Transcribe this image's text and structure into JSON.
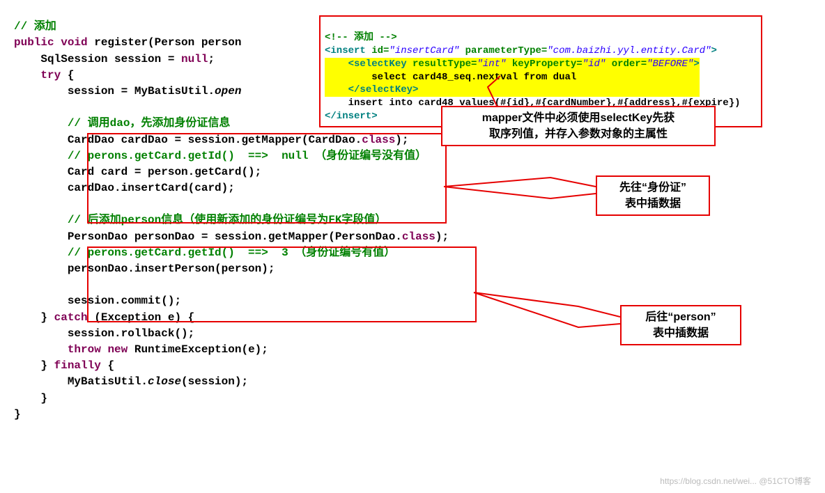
{
  "code": {
    "c_add": "// 添加",
    "sig_public": "public",
    "sig_void": "void",
    "sig_name": " register(Person person",
    "sql_decl_1": "SqlSession session = ",
    "sql_decl_null": "null",
    "sql_decl_2": ";",
    "try_kw": "try",
    "try_open": " {",
    "open_sess": "session = MyBatisUtil.",
    "open_sess_m": "open",
    "c_dao": "// 调用dao，先添加身份证信息",
    "carddao_line": "CardDao cardDao = session.getMapper(CardDao.",
    "class_kw": "class",
    "close_paren": ");",
    "c_null": "// perons.getCard.getId()  ==>  null （身份证编号没有值）",
    "card_line": "Card card = person.getCard();",
    "insert_card": "cardDao.insertCard(card);",
    "c_person": "// 后添加person信息（使用新添加的身份证编号为FK字段值）",
    "persondao_line": "PersonDao personDao = session.getMapper(PersonDao.",
    "c_id3": "// perons.getCard.getId()  ==>  3 （身份证编号有值）",
    "insert_person": "personDao.insertPerson(person);",
    "commit": "session.commit();",
    "catch_kw": "catch",
    "catch_rest": " (Exception e) {",
    "rollback": "session.rollback();",
    "throw_kw": "throw",
    "new_kw": "new",
    "rte": " RuntimeException(e);",
    "finally_kw": "finally",
    "finally_open": " {",
    "close_call_1": "MyBatisUtil.",
    "close_call_m": "close",
    "close_call_2": "(session);",
    "brace_close": "}"
  },
  "xml": {
    "cmt": "<!-- 添加 -->",
    "insert_open_1": "<insert",
    "id_attr": " id=",
    "id_val": "\"insertCard\"",
    "pt_attr": " parameterType=",
    "pt_val": "\"com.baizhi.yyl.entity.Card\"",
    "gt": ">",
    "sk_open": "<selectKey",
    "rt_attr": " resultType=",
    "rt_val": "\"int\"",
    "kp_attr": " keyProperty=",
    "kp_val": "\"id\"",
    "ord_attr": " order=",
    "ord_val": "\"BEFORE\"",
    "sk_body": "select card48_seq.nextval from dual",
    "sk_close": "</selectKey>",
    "insert_body": "insert into card48 values(#{id},#{cardNumber},#{address},#{expire})",
    "insert_close": "</insert>"
  },
  "callout": {
    "mapper": "mapper文件中必须使用selectKey先获\n取序列值，并存入参数对象的主属性",
    "card": "先往“身份证”\n表中插数据",
    "person": "后往“person”\n表中插数据"
  },
  "watermark": "https://blog.csdn.net/wei... @51CTO博客"
}
